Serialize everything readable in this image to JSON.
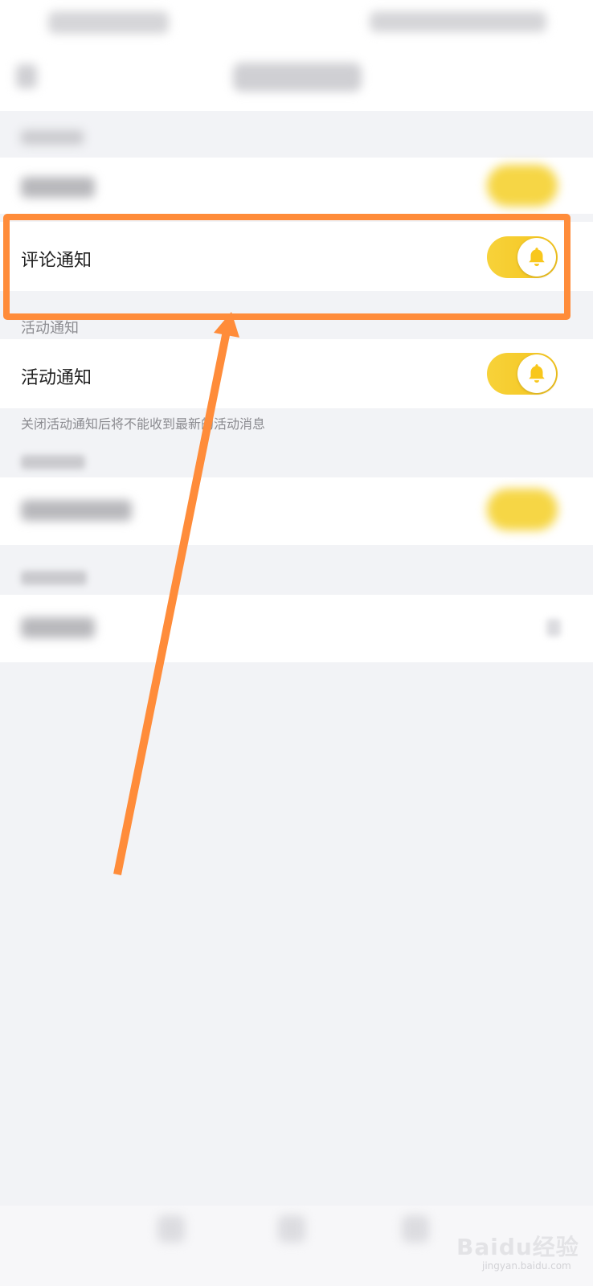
{
  "sections": [
    {
      "id": "comment",
      "row_label": "评论通知",
      "toggle_on": true
    },
    {
      "id": "activity",
      "section_label": "活动通知",
      "row_label": "活动通知",
      "toggle_on": true,
      "description": "关闭活动通知后将不能收到最新的活动消息"
    }
  ],
  "icons": {
    "toggle_knob_icon": "bell-icon"
  },
  "colors": {
    "toggle_on": "#f7d23a",
    "bell": "#f8c71c",
    "annotation": "#ff8c3a",
    "background": "#f2f3f6"
  },
  "watermark": {
    "brand": "Baidu经验",
    "url": "jingyan.baidu.com"
  }
}
